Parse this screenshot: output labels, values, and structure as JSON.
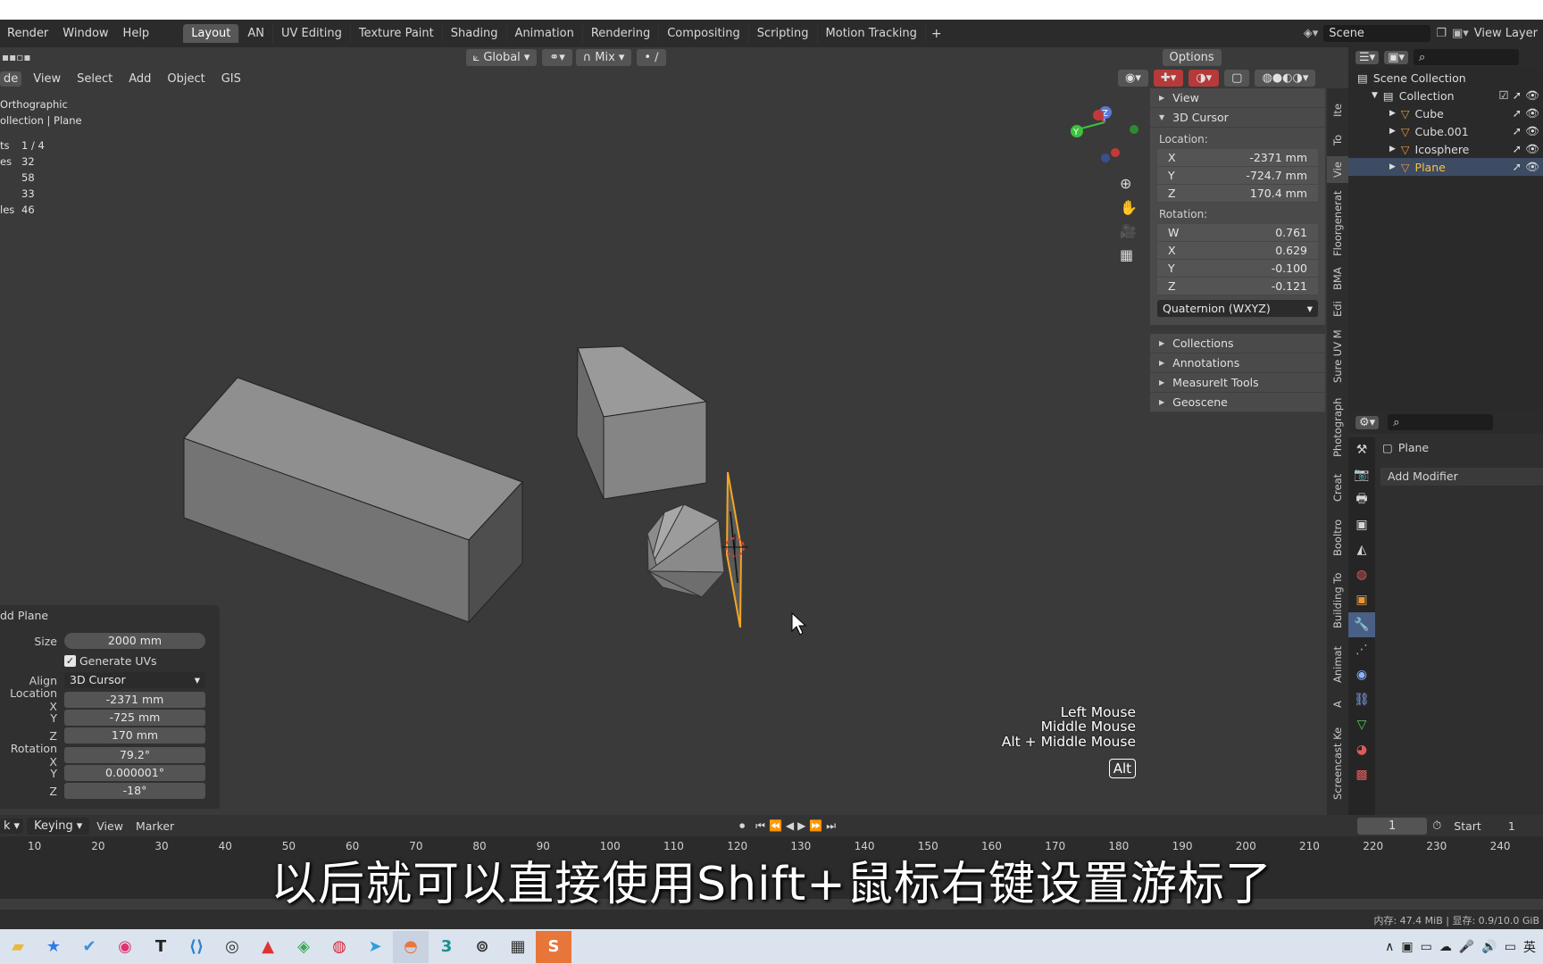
{
  "menubar": {
    "items": [
      "Render",
      "Window",
      "Help"
    ]
  },
  "workspaces": [
    "Layout",
    "AN",
    "UV Editing",
    "Texture Paint",
    "Shading",
    "Animation",
    "Rendering",
    "Compositing",
    "Scripting",
    "Motion Tracking",
    "+"
  ],
  "scene": {
    "name": "Scene",
    "view_layer": "View Layer"
  },
  "tool_header": {
    "transform": "Global",
    "snap": "Mix",
    "options": "Options"
  },
  "viewport_menu": [
    "de",
    "View",
    "Select",
    "Add",
    "Object",
    "GIS"
  ],
  "overlay_info": {
    "mode": "Orthographic",
    "collection": "ollection | Plane",
    "stats": [
      {
        "k": "ts",
        "v": "1 / 4"
      },
      {
        "k": "es",
        "v": "32"
      },
      {
        "k": "",
        "v": "58"
      },
      {
        "k": "",
        "v": "33"
      },
      {
        "k": "les",
        "v": "46"
      }
    ]
  },
  "npanel": {
    "view": "View",
    "cursor": "3D Cursor",
    "location_label": "Location:",
    "location": [
      {
        "axis": "X",
        "val": "-2371 mm"
      },
      {
        "axis": "Y",
        "val": "-724.7 mm"
      },
      {
        "axis": "Z",
        "val": "170.4 mm"
      }
    ],
    "rotation_label": "Rotation:",
    "rotation": [
      {
        "axis": "W",
        "val": "0.761"
      },
      {
        "axis": "X",
        "val": "0.629"
      },
      {
        "axis": "Y",
        "val": "-0.100"
      },
      {
        "axis": "Z",
        "val": "-0.121"
      }
    ],
    "rot_mode": "Quaternion (WXYZ)",
    "sections": [
      "Collections",
      "Annotations",
      "MeasureIt Tools",
      "Geoscene"
    ]
  },
  "sidetabs": [
    "Ite",
    "To",
    "Vie",
    "Floorgenerat",
    "BMA",
    "Edi",
    "Sure UV M",
    "Photograph",
    "Creat",
    "Booltro",
    "Building To",
    "Animat",
    "A",
    "Screencast Ke"
  ],
  "outliner": {
    "root": "Scene Collection",
    "collection": "Collection",
    "items": [
      "Cube",
      "Cube.001",
      "Icosphere",
      "Plane"
    ]
  },
  "properties": {
    "object": "Plane",
    "add_modifier": "Add Modifier"
  },
  "operator": {
    "title": "dd Plane",
    "size_label": "Size",
    "size": "2000 mm",
    "gen_uvs": "Generate UVs",
    "align_label": "Align",
    "align": "3D Cursor",
    "loc_label": "Location X",
    "loc": [
      "-2371 mm",
      "-725 mm",
      "170 mm"
    ],
    "rot_label": "Rotation X",
    "rot": [
      "79.2°",
      "0.000001°",
      "-18°"
    ],
    "y": "Y",
    "z": "Z"
  },
  "hints": {
    "left": "Left Mouse",
    "middle": "Middle Mouse",
    "alt_middle": "Alt + Middle Mouse",
    "alt": "Alt"
  },
  "timeline": {
    "keying": "Keying",
    "view": "View",
    "marker": "Marker",
    "frame": "1",
    "start_label": "Start",
    "start": "1",
    "left_label": "k",
    "ticks": [
      "10",
      "20",
      "30",
      "40",
      "50",
      "60",
      "70",
      "80",
      "90",
      "100",
      "110",
      "120",
      "130",
      "140",
      "150",
      "160",
      "170",
      "180",
      "190",
      "200",
      "210",
      "220",
      "230",
      "240"
    ]
  },
  "subtitle": "以后就可以直接使用Shift+鼠标右键设置游标了",
  "status": "内存: 47.4 MiB | 显存: 0.9/10.0 GiB",
  "taskbar_tray": "英",
  "colors": {
    "accent": "#e8963a",
    "selected": "#f5a623",
    "header": "#2b2b2b"
  }
}
